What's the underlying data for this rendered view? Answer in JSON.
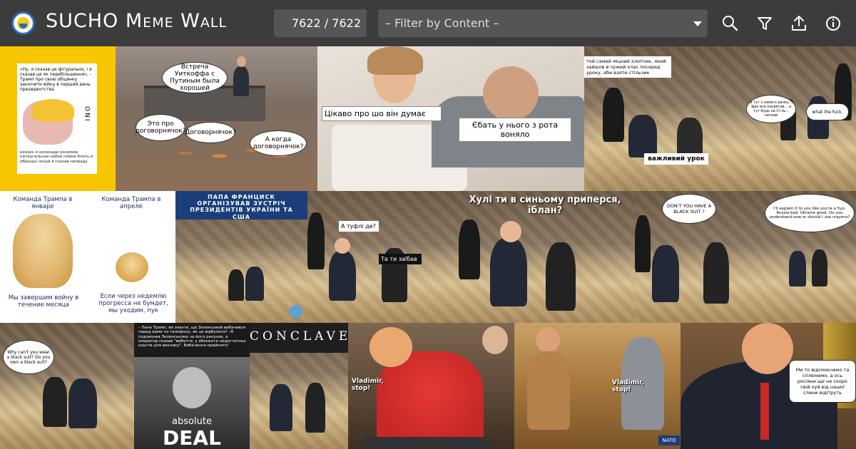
{
  "app": {
    "title": "SUCHO Meme Wall",
    "counter": "7622 / 7622",
    "filter_placeholder": "– Filter by Content –",
    "icons": [
      "search-icon",
      "filter-icon",
      "upload-icon",
      "info-icon"
    ]
  },
  "memes": {
    "m1": {
      "quote": "«Ну, я сказав це фігурально, і я сказав це як перебільшення», – Трамп про свою обіцянку закінчити війну в перший день президентства",
      "logo": "ONI",
      "footer": "ехехех я нолизаде розумею натяцгальная набое пойни блять в образдо нохуй я сказав непраду"
    },
    "m2": {
      "b1": "Встреча Уиткоффа с Путиным была хорошей",
      "b2": "Это про договорнячок?",
      "b3": "Договорнячок?",
      "b4": "А когда договорнячок?"
    },
    "m3": {
      "left": "Цікаво про шо він думає",
      "right": "Єбать у нього з рота воняло"
    },
    "m4": {
      "top": "той самий міцний хлопчик, який зайшов в чужий клас посеред уроку, аби взяти стільчик",
      "bottom": "важливий урок"
    },
    "m5": {
      "left": "а тут з самого ранку... фак все посвятив... а тут будь на Сі-ль... нечхав",
      "right": "what the fuck."
    },
    "m6": {
      "tl": "Команда Трампа в январе",
      "tr": "Команда Трампа в апреле",
      "bl": "Мы завершим войну в течение месяца",
      "br": "Если через недемлю прогресса не бумдет, мы уходим, пук"
    },
    "m7": {
      "header": "ПАПА ФРАНЦИСК ОРГАНІЗУВАВ ЗУСТРІЧ ПРЕЗИДЕНТІВ УКРАЇНИ ТА США"
    },
    "m8": {
      "b1": "А туфлі де?",
      "b2": "Та ти заїбав"
    },
    "m9": {
      "top": "Хулі ти в синьому приперся, їблан?"
    },
    "m10": {
      "b1": "DON'T YOU HAVE A BLACK SUIT ?"
    },
    "m11": {
      "b1": "I'll explain it to you like you're a 5yo. Russia bad. Ukraine good. Do you understand now or should I use crayons?"
    },
    "m12": {
      "b1": "Why can't you wear a black suit? Do you own a black suit?"
    },
    "m13": {
      "text": "– Пане Трамп, ви знаєте, що Зеленський вибачився перед вами по телефону, як це відбулося? –Я подзвонив Зеленському за його рахунок, а оператор сказав \"вибачте, у абонента недостатньо коштів для виклику\". Вибачення прийнято!",
      "sub": "absolute",
      "big": "DEAL"
    },
    "m14": {
      "title": "CONCLAVE"
    },
    "m15": {
      "caption": "Vladimir, stop!"
    },
    "m16": {
      "caption": "Vladimir, stop!",
      "corner": "NATO"
    },
    "m17": {
      "b1": "Ми то відсмокчемо та сплюнемо, а ось росіяни ще не скоро свій хуй від нашої слини відітруть"
    }
  }
}
